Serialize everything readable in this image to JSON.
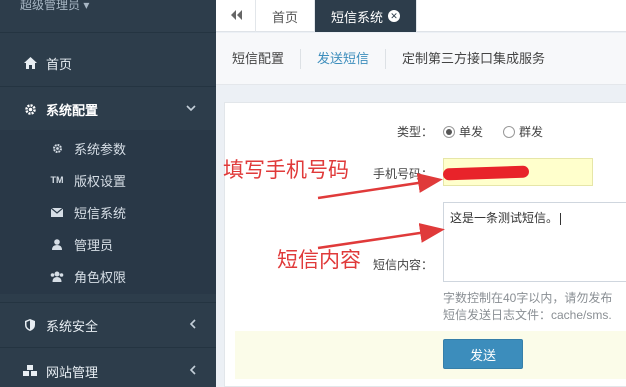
{
  "sidebar": {
    "user_label": "超级管理员 ▾",
    "items": [
      {
        "label": "首页",
        "icon": "home-icon"
      },
      {
        "label": "系统配置",
        "icon": "gear-icon",
        "chevron": "chevron-down-icon"
      },
      {
        "label": "系统安全",
        "icon": "shield-icon",
        "chevron": "chevron-left-icon"
      },
      {
        "label": "网站管理",
        "icon": "cubes-icon",
        "chevron": "chevron-left-icon"
      }
    ],
    "subitems": [
      {
        "label": "系统参数",
        "icon": "cog-icon"
      },
      {
        "label": "版权设置",
        "icon": "trademark-icon"
      },
      {
        "label": "短信系统",
        "icon": "envelope-icon"
      },
      {
        "label": "管理员",
        "icon": "user-icon"
      },
      {
        "label": "角色权限",
        "icon": "users-icon"
      }
    ]
  },
  "topbar": {
    "back_icon": "double-left-icon",
    "tabs": [
      {
        "label": "首页"
      },
      {
        "label": "短信系统",
        "close_icon": "close-icon"
      }
    ]
  },
  "subtabs": [
    "短信配置",
    "发送短信",
    "定制第三方接口集成服务"
  ],
  "form": {
    "type_label": "类型：",
    "radio_single": "单发",
    "radio_group": "群发",
    "phone_label": "手机号码：",
    "content_label": "短信内容：",
    "content_value": "这是一条测试短信。",
    "help_line1": "字数控制在40字以内，请勿发布",
    "help_line2": "短信发送日志文件：cache/sms.",
    "send_label": "发送"
  },
  "annotations": {
    "phone_note": "填写手机号码",
    "content_note": "短信内容",
    "color": "#e03a3a"
  },
  "colors": {
    "sidebar_bg": "#2d3d4b",
    "accent": "#3c8dbc",
    "phone_input_bg": "#ffffcc"
  }
}
